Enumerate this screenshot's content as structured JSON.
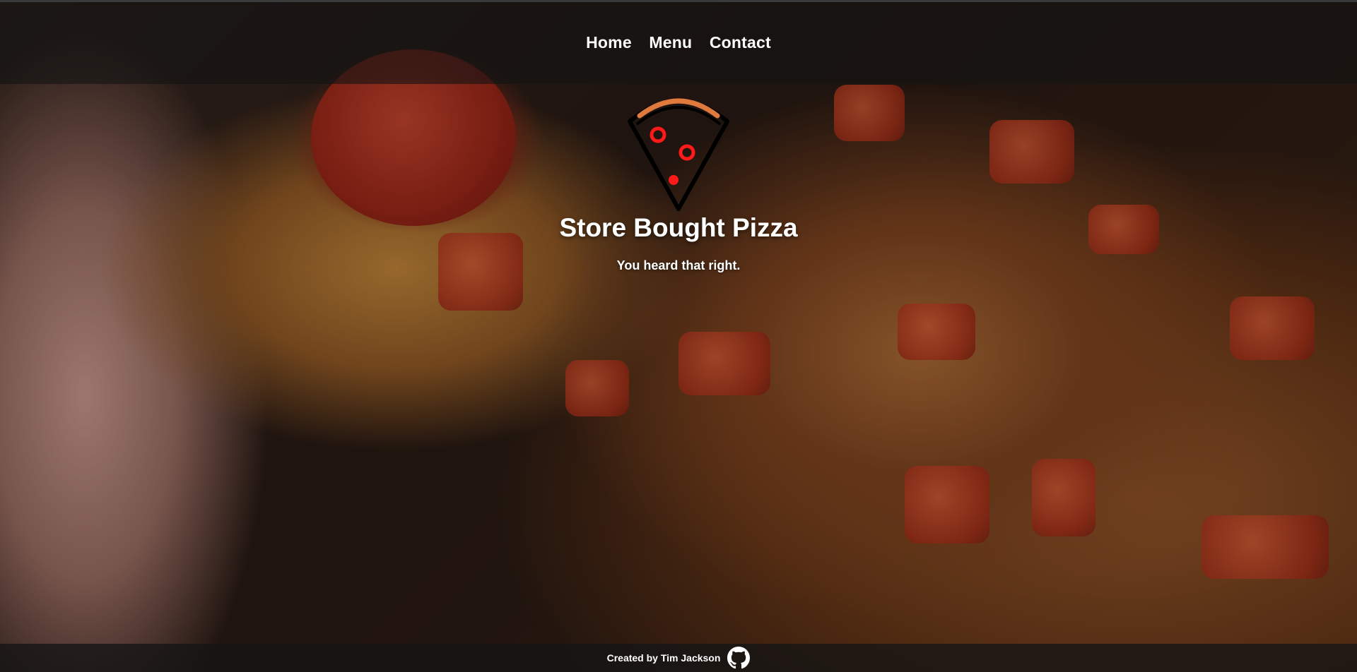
{
  "nav": {
    "items": [
      {
        "label": "Home"
      },
      {
        "label": "Menu"
      },
      {
        "label": "Contact"
      }
    ]
  },
  "hero": {
    "title": "Store Bought Pizza",
    "subtitle": "You heard that right."
  },
  "footer": {
    "credit": "Created by Tim Jackson",
    "icon": "github-icon"
  },
  "colors": {
    "nav_bg": "#141414",
    "text": "#ffffff",
    "logo_outline": "#000000",
    "logo_crust": "#e07a3c",
    "logo_pepperoni": "#ff1a1a"
  },
  "icons": {
    "logo": "pizza-slice-icon",
    "footer": "github-icon"
  }
}
